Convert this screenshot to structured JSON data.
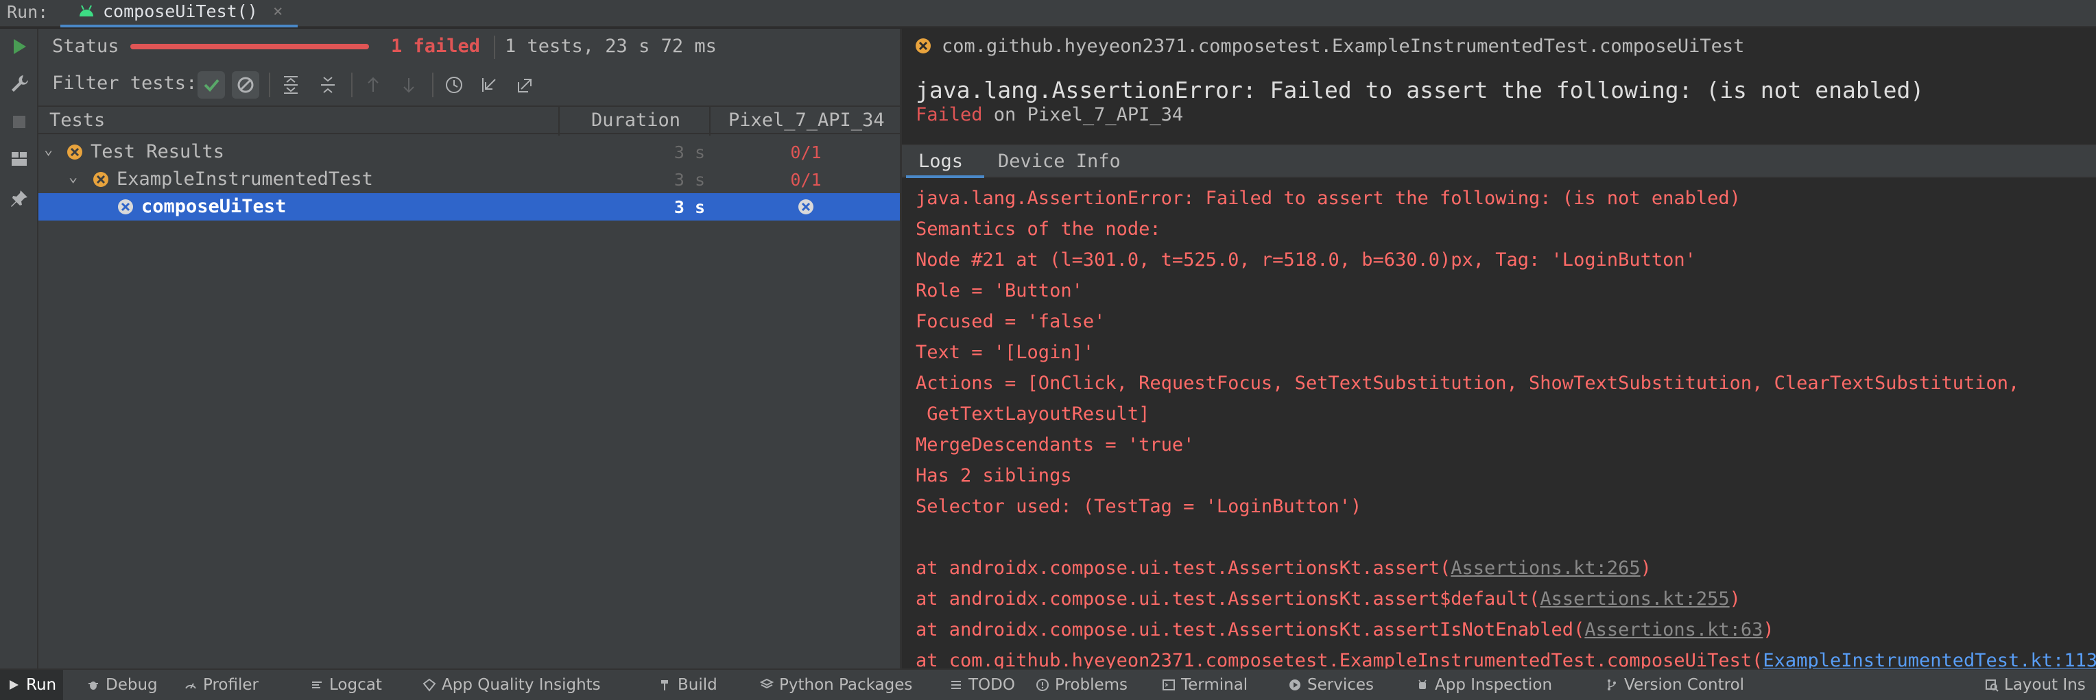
{
  "run_bar": {
    "label": "Run:",
    "tab_title": "composeUiTest()",
    "tab_close": "×"
  },
  "status": {
    "label": "Status",
    "failed_text": "1 failed",
    "summary": "1 tests, 23 s 72 ms",
    "progress_fraction": 1.0
  },
  "filter": {
    "label": "Filter tests:"
  },
  "table": {
    "headers": {
      "tests": "Tests",
      "duration": "Duration",
      "device": "Pixel_7_API_34"
    },
    "rows": [
      {
        "name": "Test Results",
        "duration": "3 s",
        "result": "0/1"
      },
      {
        "name": "ExampleInstrumentedTest",
        "duration": "3 s",
        "result": "0/1"
      },
      {
        "name": "composeUiTest",
        "duration": "3 s",
        "result": ""
      }
    ]
  },
  "detail": {
    "title": "com.github.hyeyeon2371.composetest.ExampleInstrumentedTest.composeUiTest",
    "error_heading": "java.lang.AssertionError: Failed to assert the following: (is not enabled)",
    "failed_word": "Failed",
    "failed_on": " on Pixel_7_API_34",
    "tabs": [
      "Logs",
      "Device Info"
    ],
    "log_lines": [
      "java.lang.AssertionError: Failed to assert the following: (is not enabled)",
      "Semantics of the node:",
      "Node #21 at (l=301.0, t=525.0, r=518.0, b=630.0)px, Tag: 'LoginButton'",
      "Role = 'Button'",
      "Focused = 'false'",
      "Text = '[Login]'",
      "Actions = [OnClick, RequestFocus, SetTextSubstitution, ShowTextSubstitution, ClearTextSubstitution,",
      " GetTextLayoutResult]",
      "MergeDescendants = 'true'",
      "Has 2 siblings",
      "Selector used: (TestTag = 'LoginButton')"
    ],
    "stack": [
      {
        "prefix": "at androidx.compose.ui.test.AssertionsKt.assert(",
        "link": "Assertions.kt:265",
        "suffix": ")"
      },
      {
        "prefix": "at androidx.compose.ui.test.AssertionsKt.assert$default(",
        "link": "Assertions.kt:255",
        "suffix": ")"
      },
      {
        "prefix": "at androidx.compose.ui.test.AssertionsKt.assertIsNotEnabled(",
        "link": "Assertions.kt:63",
        "suffix": ")"
      },
      {
        "prefix": "at com.github.hyeyeon2371.composetest.ExampleInstrumentedTest.composeUiTest(",
        "link": "ExampleInstrumentedTest.kt:113",
        "suffix": ")"
      }
    ]
  },
  "bottom_bar": {
    "items": [
      "Run",
      "Debug",
      "Profiler",
      "Logcat",
      "App Quality Insights",
      "Build",
      "Python Packages",
      "TODO",
      "Problems",
      "Terminal",
      "Services",
      "App Inspection",
      "Version Control",
      "Layout Ins"
    ]
  },
  "colors": {
    "failed": "#e05555",
    "selection": "#2f65ca",
    "accent": "#4a88c7",
    "run_green": "#499c54"
  }
}
